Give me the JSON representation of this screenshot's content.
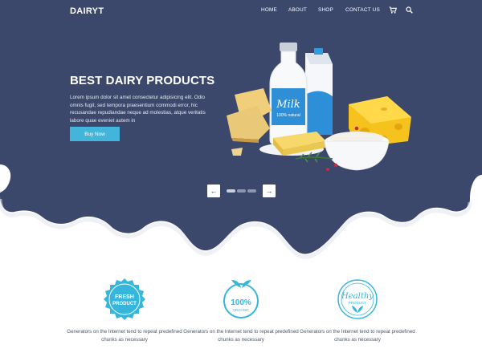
{
  "brand": {
    "logo": "DAIRYT"
  },
  "nav": {
    "items": [
      "HOME",
      "ABOUT",
      "SHOP",
      "CONTACT US"
    ],
    "icons": [
      "cart-icon",
      "search-icon"
    ]
  },
  "hero": {
    "title": "BEST DAIRY PRODUCTS",
    "text": "Lorem ipsum dolor sit amet consectetur adipisicing elit. Odio omnis fugit, sed tempora praesentium commodi error, hic recusandae repudiandae neque ad molestias, atque veritatis labore quae eveniet autem in",
    "button": "Buy Now",
    "bottle_label": "Milk",
    "bottle_sublabel": "100% natural"
  },
  "slider": {
    "prev": "←",
    "next": "→",
    "dots": 3,
    "active_dot": 0
  },
  "features": [
    {
      "badge_lines": [
        "FRESH",
        "PRODUCT"
      ],
      "text": "Generators on the Internet tend to repeat predefined chunks as necessary"
    },
    {
      "badge_lines": [
        "100%",
        "ORGANIC"
      ],
      "text": "Generators on the Internet tend to repeat predefined chunks as necessary"
    },
    {
      "badge_lines": [
        "Healthy",
        "PRODUCT"
      ],
      "text": "Generators on the Internet tend to repeat predefined chunks as necessary"
    }
  ],
  "colors": {
    "navy": "#3b486c",
    "accent": "#43b5db",
    "white": "#ffffff"
  }
}
